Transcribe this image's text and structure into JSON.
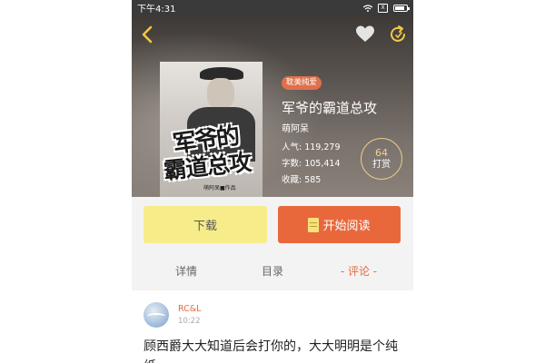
{
  "status_bar": {
    "time": "下午4:31",
    "sim_label": "X"
  },
  "header": {
    "back_icon": "chevron-left-icon",
    "favorite_icon": "heart-icon",
    "refresh_icon": "refresh-icon"
  },
  "book": {
    "cover_title_line1": "军爷的",
    "cover_title_line2": "霸道总攻",
    "cover_byline": "萌阿呆■作品",
    "tag": "耽美纯爱",
    "title": "军爷的霸道总攻",
    "author": "萌阿呆",
    "stats": [
      {
        "label": "人气:",
        "value": "119,279"
      },
      {
        "label": "字数:",
        "value": "105,414"
      },
      {
        "label": "收藏:",
        "value": "585"
      }
    ],
    "tip_count": "64",
    "tip_label": "打赏"
  },
  "actions": {
    "download_label": "下载",
    "read_label": "开始阅读"
  },
  "tabs": [
    {
      "label": "详情",
      "active": false
    },
    {
      "label": "目录",
      "active": false
    },
    {
      "label": "- 评论 -",
      "active": true
    }
  ],
  "comment": {
    "user": "RC&L",
    "time": "10:22",
    "text": "顾西爵大大知道后会打你的，大大明明是个纯纸"
  },
  "colors": {
    "accent": "#e8683c",
    "download_bg": "#f7ec8a",
    "tip_ring": "#e8c98a"
  }
}
